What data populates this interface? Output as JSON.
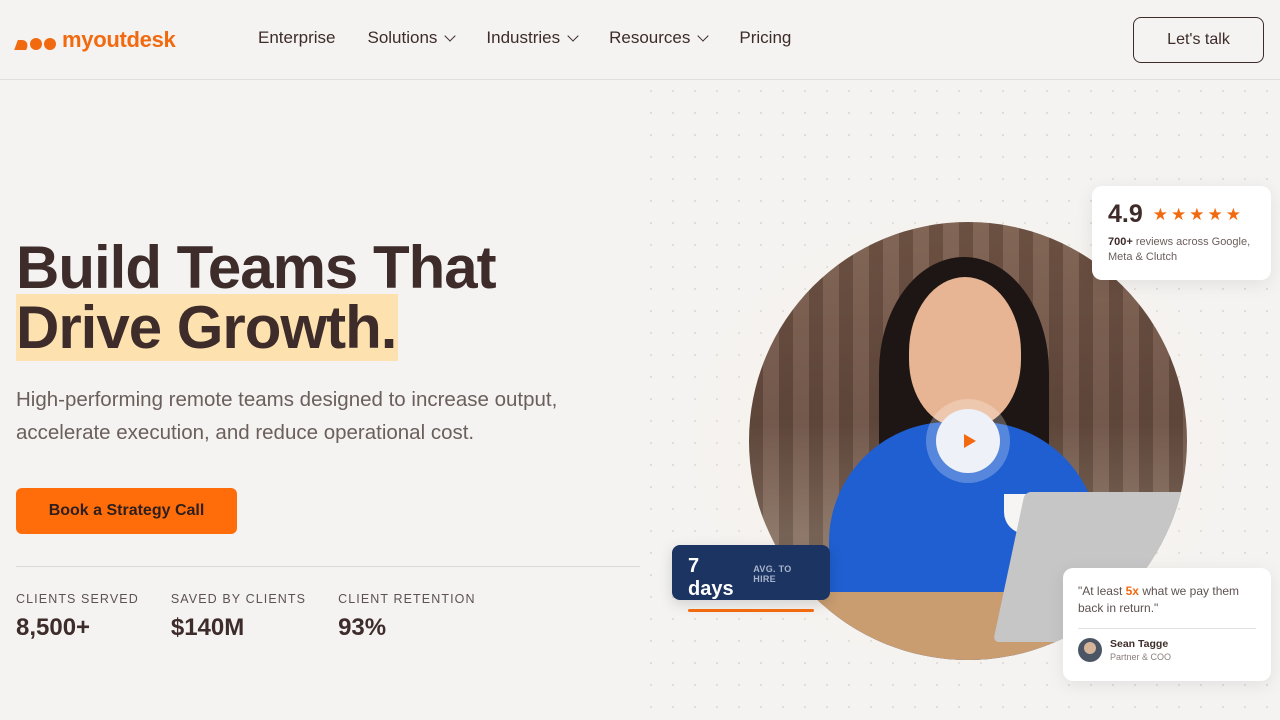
{
  "header": {
    "logo_text": "myoutdesk",
    "nav": [
      {
        "label": "Enterprise",
        "has_dropdown": false
      },
      {
        "label": "Solutions",
        "has_dropdown": true
      },
      {
        "label": "Industries",
        "has_dropdown": true
      },
      {
        "label": "Resources",
        "has_dropdown": true
      },
      {
        "label": "Pricing",
        "has_dropdown": false
      }
    ],
    "cta_label": "Let's talk"
  },
  "hero": {
    "title_line1": "Build Teams That",
    "title_line2": "Drive Growth.",
    "subtitle": "High-performing remote teams designed to increase output, accelerate execution, and reduce operational cost.",
    "cta_label": "Book a Strategy Call"
  },
  "stats": [
    {
      "label": "CLIENTS SERVED",
      "value": "8,500+"
    },
    {
      "label": "SAVED BY CLIENTS",
      "value": "$140M"
    },
    {
      "label": "CLIENT RETENTION",
      "value": "93%"
    }
  ],
  "rating_card": {
    "score": "4.9",
    "stars": "★★★★★",
    "count": "700+",
    "text": " reviews across Google, Meta & Clutch"
  },
  "hire_card": {
    "value": "7 days",
    "label": "AVG. TO HIRE"
  },
  "quote_card": {
    "pre": "\"At least ",
    "emphasis": "5x",
    "post": " what we pay them back in return.\"",
    "name": "Sean Tagge",
    "role": "Partner & COO"
  },
  "colors": {
    "accent": "#ff6d0a",
    "brand": "#f26a10",
    "highlight": "#fde2b0",
    "text": "#3d2c2a",
    "hire_card_bg": "#1c3461"
  },
  "icons": [
    "logo-icon",
    "chevron-down-icon",
    "play-icon",
    "star-icon",
    "avatar"
  ]
}
